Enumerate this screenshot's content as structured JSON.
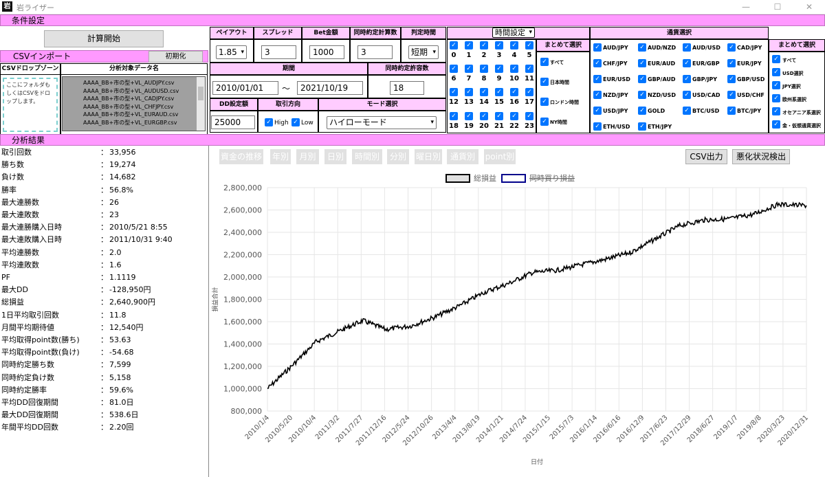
{
  "window": {
    "title": "岩ライザー",
    "icon_glyph": "岩",
    "minimize_glyph": "—",
    "maximize_glyph": "☐",
    "close_glyph": "✕"
  },
  "conditions": {
    "label": "条件設定"
  },
  "calc_button": "計算開始",
  "csv_import": {
    "label": "CSVインポート",
    "reset_button": "初期化",
    "drop_zone_header": "CSVドロップゾーン",
    "drop_zone_text": "ここにフォルダもしくはCSVをドロップします。",
    "list_header": "分析対象データ名"
  },
  "csv_files": [
    "AAAA_BB+市の型+VL_AUDJPY.csv",
    "AAAA_BB+市の型+VL_AUDUSD.csv",
    "AAAA_BB+市の型+VL_CADJPY.csv",
    "AAAA_BB+市の型+VL_CHFJPY.csv",
    "AAAA_BB+市の型+VL_EURAUD.csv",
    "AAAA_BB+市の型+VL_EURGBP.csv"
  ],
  "settings": {
    "payout_header": "ペイアウト",
    "payout_value": "1.85",
    "spread_header": "スプレッド",
    "spread_value": "3",
    "bet_header": "Bet金額",
    "bet_value": "1000",
    "sim_count_header": "同時約定計算数",
    "sim_count_value": "3",
    "judge_header": "判定時間",
    "judge_value": "短期",
    "period_header": "期間",
    "date_from": "2010/01/01",
    "date_sep": "〜",
    "date_to": "2021/10/19",
    "sim_allow_header": "同時約定許容数",
    "sim_allow_value": "18",
    "dd_header": "DD設定額",
    "dd_value": "25000",
    "direction_header": "取引方向",
    "high_label": "High",
    "low_label": "Low",
    "mode_header": "モード選択",
    "mode_value": "ハイローモード"
  },
  "time_settings": {
    "select": "時間設定",
    "hours": [
      "0",
      "1",
      "2",
      "3",
      "4",
      "5",
      "6",
      "7",
      "8",
      "9",
      "10",
      "11",
      "12",
      "13",
      "14",
      "15",
      "16",
      "17",
      "18",
      "19",
      "20",
      "21",
      "22",
      "23"
    ],
    "group_header": "まとめて選択",
    "groups": [
      "すべて",
      "日本時間",
      "ロンドン時間",
      "NY時間"
    ]
  },
  "currency": {
    "header": "通貨選択",
    "pairs": [
      "AUD/JPY",
      "AUD/NZD",
      "AUD/USD",
      "CAD/JPY",
      "CHF/JPY",
      "EUR/AUD",
      "EUR/GBP",
      "EUR/JPY",
      "EUR/USD",
      "GBP/AUD",
      "GBP/JPY",
      "GBP/USD",
      "NZD/JPY",
      "NZD/USD",
      "USD/CAD",
      "USD/CHF",
      "USD/JPY",
      "GOLD",
      "BTC/USD",
      "BTC/JPY",
      "ETH/USD",
      "ETH/JPY"
    ],
    "group_header": "まとめて選択",
    "groups": [
      "すべて",
      "USD選択",
      "JPY選択",
      "欧州系選択",
      "オセアニア系選択",
      "金・仮想通貨選択"
    ]
  },
  "analysis": {
    "label": "分析結果"
  },
  "stats": [
    {
      "label": "取引回数",
      "value": "33,956"
    },
    {
      "label": "勝ち数",
      "value": "19,274"
    },
    {
      "label": "負け数",
      "value": "14,682"
    },
    {
      "label": "勝率",
      "value": "56.8%"
    },
    {
      "label": "最大連勝数",
      "value": "26"
    },
    {
      "label": "最大連敗数",
      "value": "23"
    },
    {
      "label": "最大連勝購入日時",
      "value": "2010/5/21 8:55"
    },
    {
      "label": "最大連敗購入日時",
      "value": "2011/10/31 9:40"
    },
    {
      "label": "平均連勝数",
      "value": "2.0"
    },
    {
      "label": "平均連敗数",
      "value": "1.6"
    },
    {
      "label": "PF",
      "value": "1.1119"
    },
    {
      "label": "最大DD",
      "value": "-128,950円"
    },
    {
      "label": "総損益",
      "value": "2,640,900円"
    },
    {
      "label": "1日平均取引回数",
      "value": "11.8"
    },
    {
      "label": "月間平均期待値",
      "value": "12,540円"
    },
    {
      "label": "平均取得point数(勝ち)",
      "value": "53.63"
    },
    {
      "label": "平均取得point数(負け)",
      "value": "-54.68"
    },
    {
      "label": "同時約定勝ち数",
      "value": "7,599"
    },
    {
      "label": "同時約定負け数",
      "value": "5,158"
    },
    {
      "label": "同時約定勝率",
      "value": "59.6%"
    },
    {
      "label": "平均DD回復期間",
      "value": "81.0日"
    },
    {
      "label": "最大DD回復期間",
      "value": "538.6日"
    },
    {
      "label": "年間平均DD回数",
      "value": "2.20回"
    }
  ],
  "stat_colon": "：",
  "tabs": [
    "資金の推移",
    "年別",
    "月別",
    "日別",
    "時間別",
    "分別",
    "曜日別",
    "通貨別",
    "point別"
  ],
  "csv_export": "CSV出力",
  "worst_detect": "悪化状況検出",
  "check_glyph": "✓",
  "chevron_glyph": "▾",
  "chart_data": {
    "type": "line",
    "xlabel": "日付",
    "ylabel": "損益合計",
    "ylim": [
      800000,
      2800000
    ],
    "yticks": [
      "800,000",
      "1,000,000",
      "1,200,000",
      "1,400,000",
      "1,600,000",
      "1,800,000",
      "2,000,000",
      "2,200,000",
      "2,400,000",
      "2,600,000",
      "2,800,000"
    ],
    "xticks": [
      "2010/1/4",
      "2010/5/20",
      "2010/10/4",
      "2011/3/2",
      "2011/7/27",
      "2011/12/16",
      "2012/5/24",
      "2012/10/26",
      "2013/4/4",
      "2013/8/19",
      "2014/1/21",
      "2014/7/24",
      "2015/1/15",
      "2015/7/3",
      "2016/1/14",
      "2016/6/16",
      "2016/12/9",
      "2017/6/23",
      "2017/12/29",
      "2018/6/27",
      "2019/1/7",
      "2019/8/8",
      "2020/3/23",
      "2020/12/31"
    ],
    "grid": true,
    "legend_position": "top",
    "series": [
      {
        "name": "総損益",
        "color": "#000000",
        "x": [
          "2010/01/04",
          "2010/07/01",
          "2011/01/01",
          "2011/07/01",
          "2011/12/16",
          "2012/06/01",
          "2012/12/01",
          "2013/06/01",
          "2013/12/01",
          "2014/06/01",
          "2014/12/01",
          "2015/06/01",
          "2015/12/01",
          "2016/06/01",
          "2016/12/01",
          "2017/06/01",
          "2017/12/01",
          "2018/06/01",
          "2018/12/01",
          "2019/06/01",
          "2019/12/01",
          "2020/06/01",
          "2020/12/31"
        ],
        "values": [
          1000000,
          1200000,
          1420000,
          1520000,
          1610000,
          1530000,
          1560000,
          1640000,
          1740000,
          1860000,
          1940000,
          2040000,
          2060000,
          2110000,
          2160000,
          2220000,
          2340000,
          2460000,
          2510000,
          2520000,
          2560000,
          2650000,
          2640000
        ]
      },
      {
        "name": "同時買り損益",
        "color": "#00008b",
        "x": [],
        "values": []
      }
    ]
  }
}
